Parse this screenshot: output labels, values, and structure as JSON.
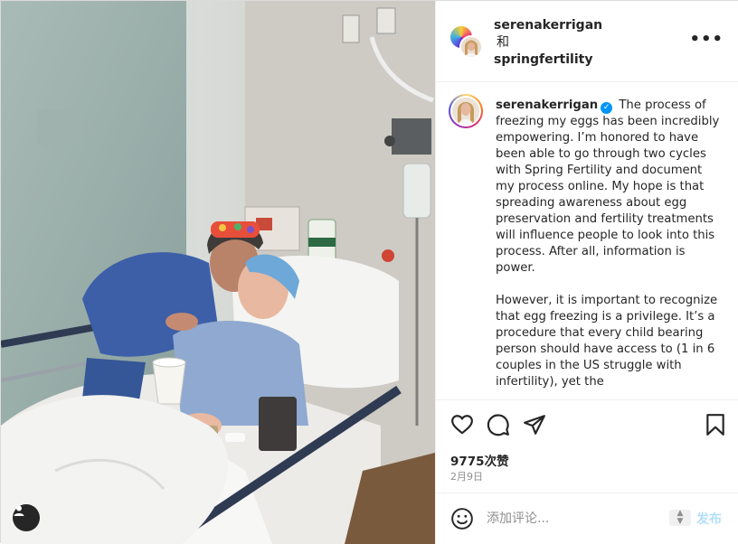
{
  "header": {
    "user1": "serenakerrigan",
    "conjunction": "和",
    "user2": "springfertility",
    "more": "•••"
  },
  "caption": {
    "username": "serenakerrigan",
    "verified_mark": "✓",
    "paragraph1": "The process of freezing my eggs has been incredibly empowering. I’m honored to have been able to go through two cycles with Spring Fertility and document my process online. My hope is that spreading awareness about egg preservation and fertility treatments will influence people to look into this process. After all, information is power.",
    "paragraph2": "However, it is important to recognize that egg freezing is a privilege. It’s a procedure that every child bearing person should have access to (1 in 6 couples in the US struggle with infertility), yet the"
  },
  "actions": {
    "likes": "9775次赞",
    "date": "2月9日",
    "icons": [
      "heart-icon",
      "comment-icon",
      "share-icon",
      "bookmark-icon"
    ]
  },
  "comment": {
    "placeholder": "添加评论...",
    "post_label": "发布",
    "post_color": "#b2dffc"
  },
  "colors": {
    "verified": "#0095f6",
    "border": "#efefef"
  }
}
